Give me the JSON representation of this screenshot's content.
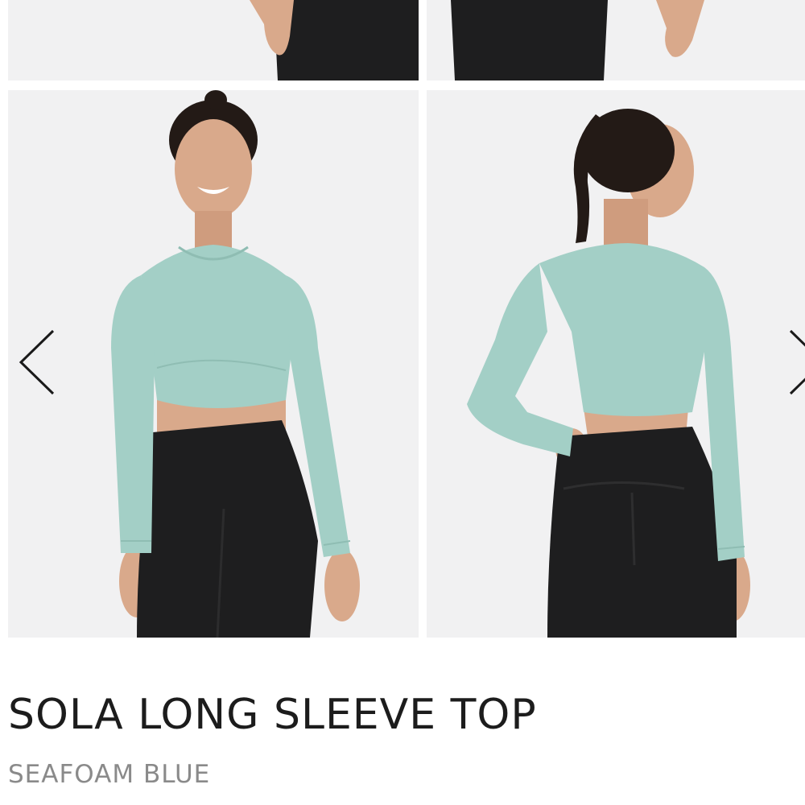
{
  "gallery": {
    "images": [
      {
        "name": "legs-front-crop",
        "alt": ""
      },
      {
        "name": "legs-back-crop",
        "alt": ""
      },
      {
        "name": "model-front",
        "alt": ""
      },
      {
        "name": "model-back",
        "alt": ""
      }
    ],
    "prev_icon": "chevron-left-icon",
    "next_icon": "chevron-right-icon"
  },
  "product": {
    "title": "SOLA LONG SLEEVE TOP",
    "color": "SEAFOAM BLUE"
  },
  "colors": {
    "top_fabric": "#a3cfc6",
    "leggings": "#1e1e1f",
    "photo_bg": "#f1f1f2",
    "title_text": "#1c1c1c",
    "subtitle_text": "#8a8a8a",
    "skin": "#d9a98b",
    "hair": "#231a16"
  }
}
